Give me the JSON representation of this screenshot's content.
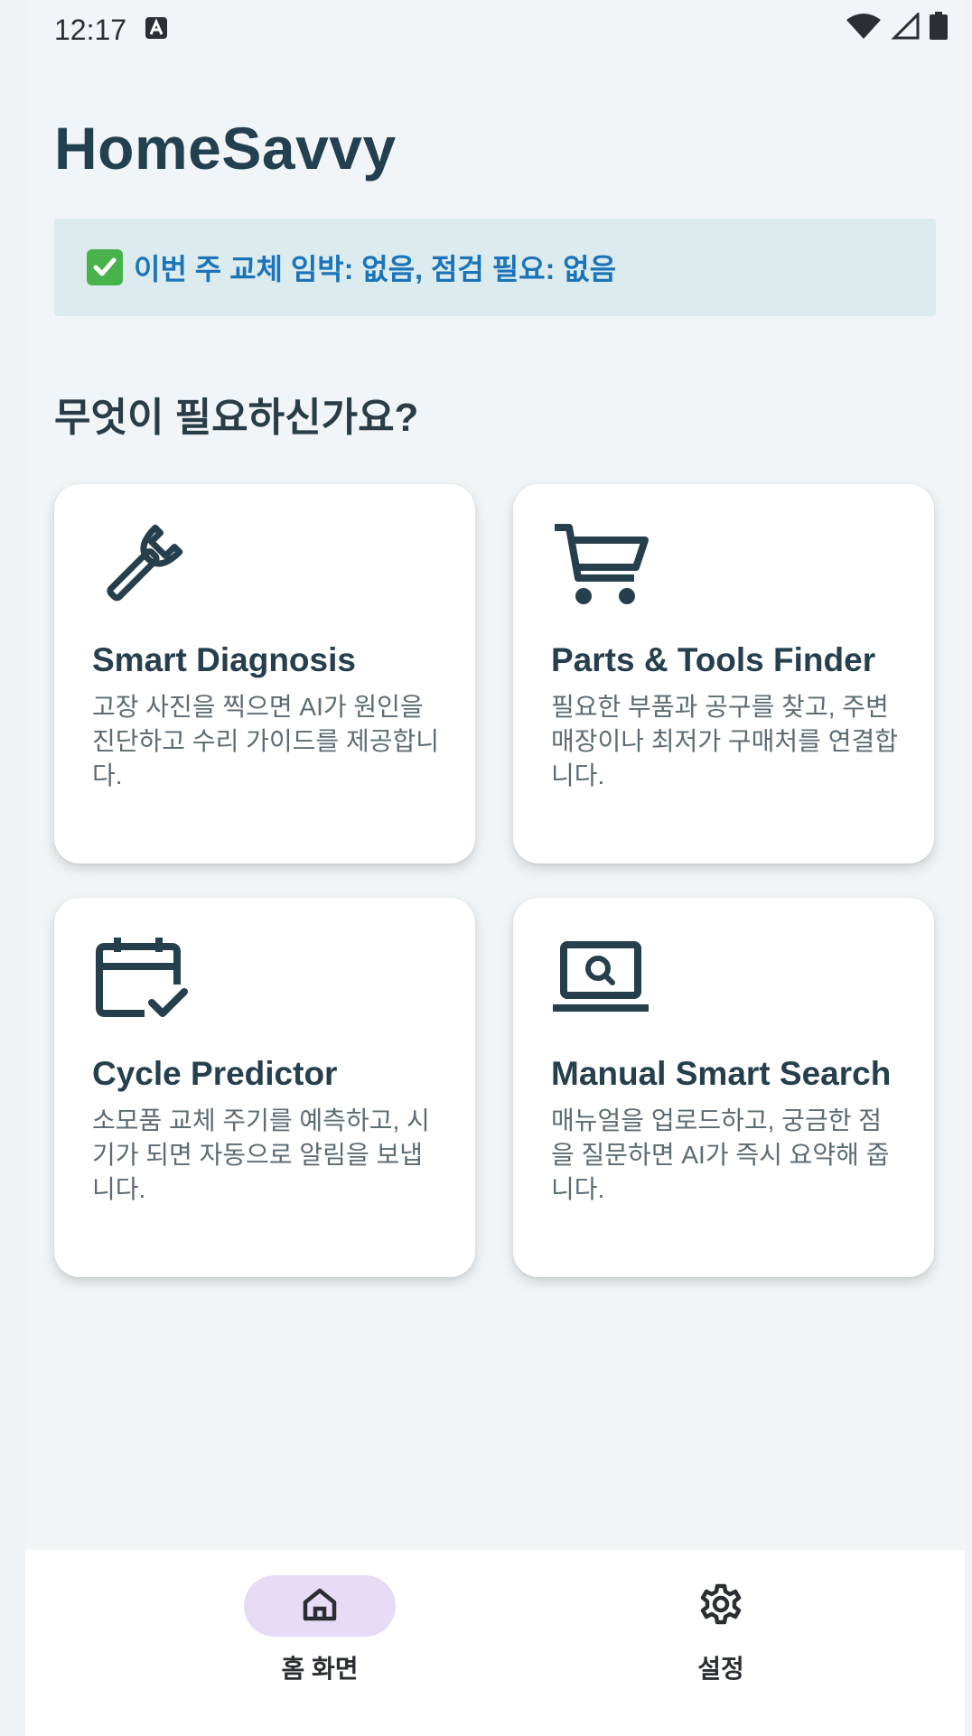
{
  "status_bar": {
    "time": "12:17",
    "icons": [
      "notification-a-icon",
      "wifi-icon",
      "cell-signal-icon",
      "battery-icon"
    ]
  },
  "app": {
    "title": "HomeSavvy"
  },
  "banner": {
    "icon": "check-mark-icon",
    "text": "이번 주 교체 임박: 없음, 점검 필요: 없음"
  },
  "section": {
    "title": "무엇이 필요하신가요?"
  },
  "cards": [
    {
      "icon": "wrench-icon",
      "title": "Smart Diagnosis",
      "description": "고장 사진을 찍으면 AI가 원인을 진단하고 수리 가이드를 제공합니다."
    },
    {
      "icon": "shopping-cart-icon",
      "title": "Parts & Tools Finder",
      "description": "필요한 부품과 공구를 찾고, 주변 매장이나 최저가 구매처를 연결합니다."
    },
    {
      "icon": "calendar-check-icon",
      "title": "Cycle Predictor",
      "description": "소모품 교체 주기를 예측하고, 시기가 되면 자동으로 알림을 보냅니다."
    },
    {
      "icon": "laptop-search-icon",
      "title": "Manual Smart Search",
      "description": "매뉴얼을 업로드하고, 궁금한 점을 질문하면 AI가 즉시 요약해 줍니다."
    }
  ],
  "bottom_nav": {
    "items": [
      {
        "label": "홈 화면",
        "icon": "home-icon",
        "active": true
      },
      {
        "label": "설정",
        "icon": "gear-icon",
        "active": false
      }
    ]
  },
  "colors": {
    "background": "#f1f5f7",
    "title": "#22404f",
    "banner_bg": "#dcecee",
    "banner_text": "#1b73b8",
    "check_green": "#47b34a",
    "active_nav_pill": "#e6dcf5"
  }
}
